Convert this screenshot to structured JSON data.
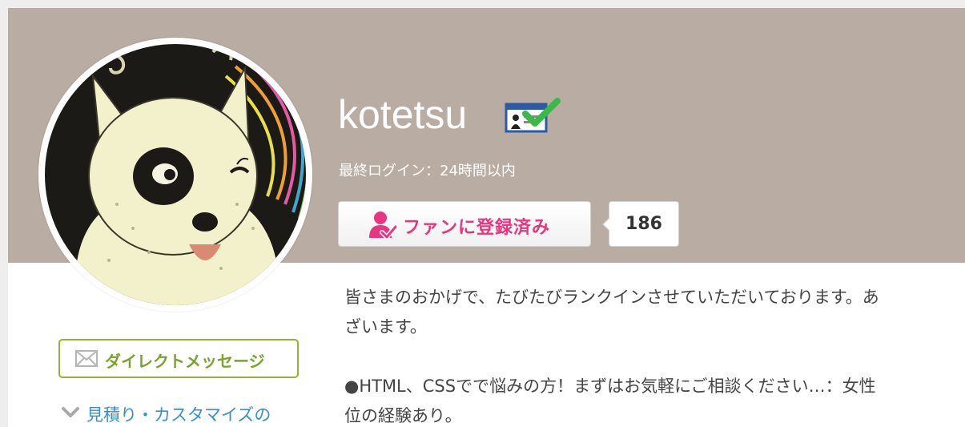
{
  "profile": {
    "username": "kotetsu",
    "last_login": "最終ログイン：24時間以内",
    "verified_icon": "id-verified-icon",
    "avatar_icon": "dog-avatar"
  },
  "fan": {
    "button_label": "ファンに登録済み",
    "count": "186",
    "icon": "user-check-icon",
    "color": "#e8357f"
  },
  "sidebar": {
    "dm_label": "ダイレクトメッセージ",
    "dm_icon": "mail-icon",
    "dm_color": "#8fb339",
    "estimate_label": "見積り・カスタマイズの",
    "estimate_icon": "chevron-down-icon",
    "link_color": "#3a8fc4"
  },
  "bio": {
    "lines": [
      "皆さまのおかげで、たびたびランクインさせていただいております。あ",
      "ざいます。",
      "",
      "●HTML、CSSでで悩みの方！まずはお気軽にご相談ください…：女性",
      "位の経験あり。"
    ]
  },
  "colors": {
    "banner": "#b9aca3",
    "background": "#eeeeee"
  }
}
